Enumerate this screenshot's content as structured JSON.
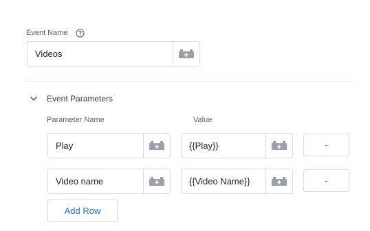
{
  "event_name": {
    "label": "Event Name",
    "help_icon": "help-circle-icon",
    "value": "Videos",
    "variable_icon": "variable-brick-icon"
  },
  "event_parameters": {
    "section_title": "Event Parameters",
    "toggle_icon": "chevron-down-icon",
    "column_headers": {
      "name": "Parameter Name",
      "value": "Value"
    },
    "rows": [
      {
        "name": "Play",
        "value": "{{Play}}",
        "remove_label": "-"
      },
      {
        "name": "Video name",
        "value": "{{Video Name}}",
        "remove_label": "-"
      }
    ],
    "add_row_label": "Add Row"
  },
  "colors": {
    "accent": "#1a73e8",
    "border": "#dadce0",
    "icon": "#9aa0a6",
    "label": "#5f6368"
  }
}
